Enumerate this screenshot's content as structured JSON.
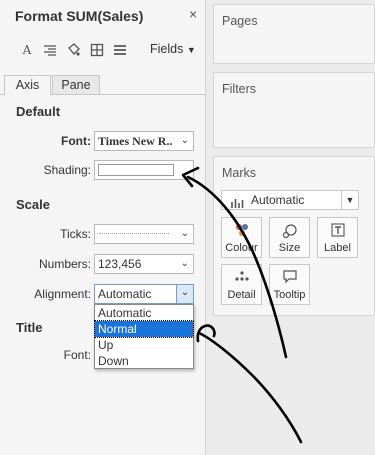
{
  "format_pane": {
    "title": "Format SUM(Sales)",
    "close": "×",
    "fields_label": "Fields",
    "tabs": [
      {
        "label": "Axis",
        "active": true
      },
      {
        "label": "Pane",
        "active": false
      }
    ],
    "sections": {
      "default": "Default",
      "scale": "Scale",
      "title": "Title"
    },
    "rows": {
      "font_label": "Font:",
      "font_value": "Times New R..",
      "shading_label": "Shading:",
      "ticks_label": "Ticks:",
      "numbers_label": "Numbers:",
      "numbers_value": "123,456",
      "alignment_label": "Alignment:",
      "alignment_value": "Automatic",
      "title_font_label": "Font:"
    },
    "alignment_options": [
      {
        "label": "Automatic",
        "selected": false
      },
      {
        "label": "Normal",
        "selected": true
      },
      {
        "label": "Up",
        "selected": false
      },
      {
        "label": "Down",
        "selected": false
      }
    ]
  },
  "right_panels": {
    "pages_title": "Pages",
    "filters_title": "Filters",
    "marks_title": "Marks",
    "mark_type": "Automatic",
    "mark_buttons": [
      {
        "label": "Colour",
        "icon": "colour-dots-icon"
      },
      {
        "label": "Size",
        "icon": "size-icon"
      },
      {
        "label": "Label",
        "icon": "label-T-icon"
      },
      {
        "label": "Detail",
        "icon": "detail-dots-icon"
      },
      {
        "label": "Tooltip",
        "icon": "tooltip-bubble-icon"
      }
    ]
  },
  "colors": {
    "selected_option": "#1a73d9",
    "colour_dot_red": "#e15759",
    "colour_dot_blue": "#4e79a7",
    "colour_dot_orange": "#f28e2b"
  }
}
